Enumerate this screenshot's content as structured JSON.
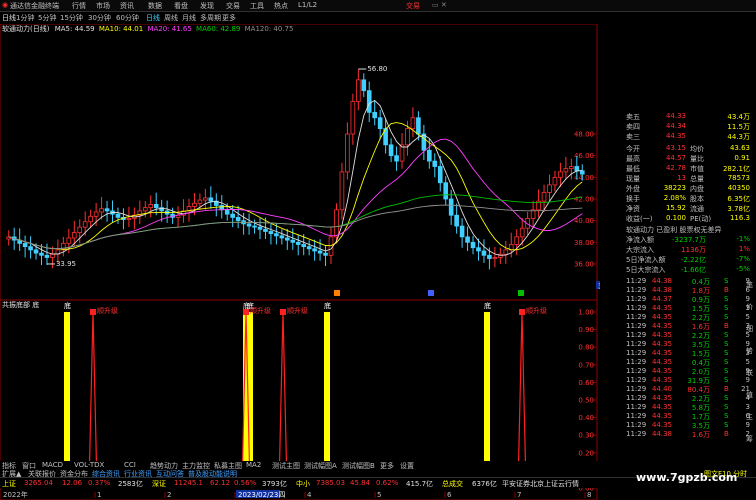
{
  "titlebar": {
    "app": "通达信金融终端",
    "menus": [
      "行情",
      "市场",
      "资讯",
      "数据",
      "看盘",
      "发现",
      "交易",
      "工具",
      "热点",
      "L1/L2"
    ],
    "right": "交易"
  },
  "periods": [
    "日线",
    "1分钟",
    "5分钟",
    "15分钟",
    "30分钟",
    "60分钟",
    "日线",
    "周线",
    "月线",
    "多周期",
    "更多"
  ],
  "chart_info": {
    "name": "软通动力(日线)",
    "ma5": "MA5: 44.59",
    "ma10": "MA10: 44.01",
    "ma20": "MA20: 41.65",
    "ma60": "MA60: 42.89",
    "ma120": "MA120: 40.75"
  },
  "price_axis": [
    "48.00",
    "46.00",
    "44.00",
    "42.00",
    "40.00",
    "38.00",
    "36.00",
    "33.97"
  ],
  "annotations": {
    "high": "56.80",
    "low": "33.95"
  },
  "indicator_name": "共振底部  底",
  "indicator_axis": [
    "1.00",
    "0.90",
    "0.80",
    "0.70",
    "0.60",
    "0.50",
    "0.40",
    "0.30",
    "0.20",
    "0.10",
    "0.00"
  ],
  "signals": {
    "bottom": "底",
    "top": "顺升级"
  },
  "date_axis": {
    "start": "2022年",
    "marker": "2023/02/23四",
    "ticks": [
      "1",
      "2",
      "3",
      "4",
      "5",
      "6",
      "7",
      "8"
    ]
  },
  "bottom_tabs": [
    "指标",
    "窗口",
    "MACD",
    "VOL-TDX",
    "CCI",
    "趋势动力",
    "主力监控",
    "私募主图",
    "MA2",
    "测试主图",
    "测试幅图A",
    "测试幅图B",
    "更多",
    "设置"
  ],
  "bottom_tabs2": [
    "扩展▲",
    "关联报价",
    "资金分布",
    "综合资讯",
    "行业资讯",
    "互动问答",
    "普及股动能说明"
  ],
  "index_bar": {
    "sh_label": "上证",
    "sh": "3265.04",
    "sh_chg": "12.06",
    "sh_pct": "0.37%",
    "sh_amt": "2583亿",
    "sz_label": "深证",
    "sz": "11245.1",
    "sz_chg": "62.12",
    "sz_pct": "0.56%",
    "sz_amt": "3793亿",
    "zx_label": "中小",
    "zx": "7385.03",
    "zx_chg": "45.84",
    "zx_pct": "0.62%",
    "zx_amt": "415.7亿",
    "total_label": "总成交",
    "total": "6376亿",
    "news": "平安证券北京上证云行情"
  },
  "quote": {
    "sells": [
      {
        "l": "卖五",
        "p": "44.33",
        "v": "43.4万"
      },
      {
        "l": "卖四",
        "p": "44.34",
        "v": "11.5万"
      },
      {
        "l": "卖三",
        "p": "44.35",
        "v": "44.3万"
      }
    ],
    "fields": [
      {
        "a": "今开",
        "av": "43.15",
        "b": "均价",
        "bv": "43.63"
      },
      {
        "a": "最高",
        "av": "44.57",
        "b": "量比",
        "bv": "0.91"
      },
      {
        "a": "最低",
        "av": "42.78",
        "b": "市值",
        "bv": "282.1亿"
      },
      {
        "a": "现量",
        "av": "13",
        "b": "总量",
        "bv": "78573"
      },
      {
        "a": "外盘",
        "av": "38223",
        "b": "内盘",
        "bv": "40350"
      },
      {
        "a": "换手",
        "av": "2.08%",
        "b": "股本",
        "bv": "6.35亿"
      },
      {
        "a": "净资",
        "av": "15.92",
        "b": "流通",
        "bv": "3.78亿"
      },
      {
        "a": "收益(一)",
        "av": "0.100",
        "b": "PE(动)",
        "bv": "116.3"
      }
    ],
    "status": "软通动力 已盈利 股票权无差异",
    "flows": [
      {
        "l": "净流入额",
        "v": "-3237.7万",
        "p": "-1%"
      },
      {
        "l": "大宗流入",
        "v": "1136万",
        "p": "1%"
      },
      {
        "l": "5日净流入额",
        "v": "-2.22亿",
        "p": "-7%"
      },
      {
        "l": "5日大宗流入",
        "v": "-1.66亿",
        "p": "-5%"
      }
    ],
    "ticks": [
      {
        "t": "11:29",
        "p": "44.38",
        "v": "0.4万",
        "s": "S",
        "n": "9"
      },
      {
        "t": "11:29",
        "p": "44.38",
        "v": "1.8万",
        "s": "B",
        "n": "6"
      },
      {
        "t": "11:29",
        "p": "44.37",
        "v": "0.9万",
        "s": "S",
        "n": "9"
      },
      {
        "t": "11:29",
        "p": "44.35",
        "v": "1.5万",
        "s": "S",
        "n": "3"
      },
      {
        "t": "11:29",
        "p": "44.35",
        "v": "2.2万",
        "s": "S",
        "n": "5"
      },
      {
        "t": "11:29",
        "p": "44.35",
        "v": "1.6万",
        "s": "B",
        "n": "3"
      },
      {
        "t": "11:29",
        "p": "44.35",
        "v": "2.2万",
        "s": "S",
        "n": "5"
      },
      {
        "t": "11:29",
        "p": "44.35",
        "v": "3.5万",
        "s": "S",
        "n": "9"
      },
      {
        "t": "11:29",
        "p": "44.35",
        "v": "1.5万",
        "s": "S",
        "n": "3"
      },
      {
        "t": "11:29",
        "p": "44.35",
        "v": "0.4万",
        "s": "S",
        "n": "5"
      },
      {
        "t": "11:29",
        "p": "44.35",
        "v": "2.0万",
        "s": "S",
        "n": "9"
      },
      {
        "t": "11:29",
        "p": "44.35",
        "v": "31.9万",
        "s": "S",
        "n": "9"
      },
      {
        "t": "11:29",
        "p": "44.40",
        "v": "80.4万",
        "s": "B",
        "n": "21"
      },
      {
        "t": "11:29",
        "p": "44.35",
        "v": "2.2万",
        "s": "S",
        "n": "4"
      },
      {
        "t": "11:29",
        "p": "44.35",
        "v": "5.8万",
        "s": "S",
        "n": "3"
      },
      {
        "t": "11:29",
        "p": "44.35",
        "v": "1.7万",
        "s": "S",
        "n": "6"
      },
      {
        "t": "11:29",
        "p": "44.35",
        "v": "3.5万",
        "s": "S",
        "n": "9"
      },
      {
        "t": "11:29",
        "p": "44.38",
        "v": "1.6万",
        "s": "B",
        "n": "2"
      }
    ],
    "bottom_label": "图文F10 分时"
  },
  "watermark": "www.7gpzb.com",
  "colors": {
    "bg": "#000000",
    "up": "#ff3030",
    "down": "#40d0ff",
    "ma5": "#e0e0e0",
    "ma10": "#ffff00",
    "ma20": "#ff40ff",
    "ma60": "#00c000",
    "ma120": "#909090"
  }
}
